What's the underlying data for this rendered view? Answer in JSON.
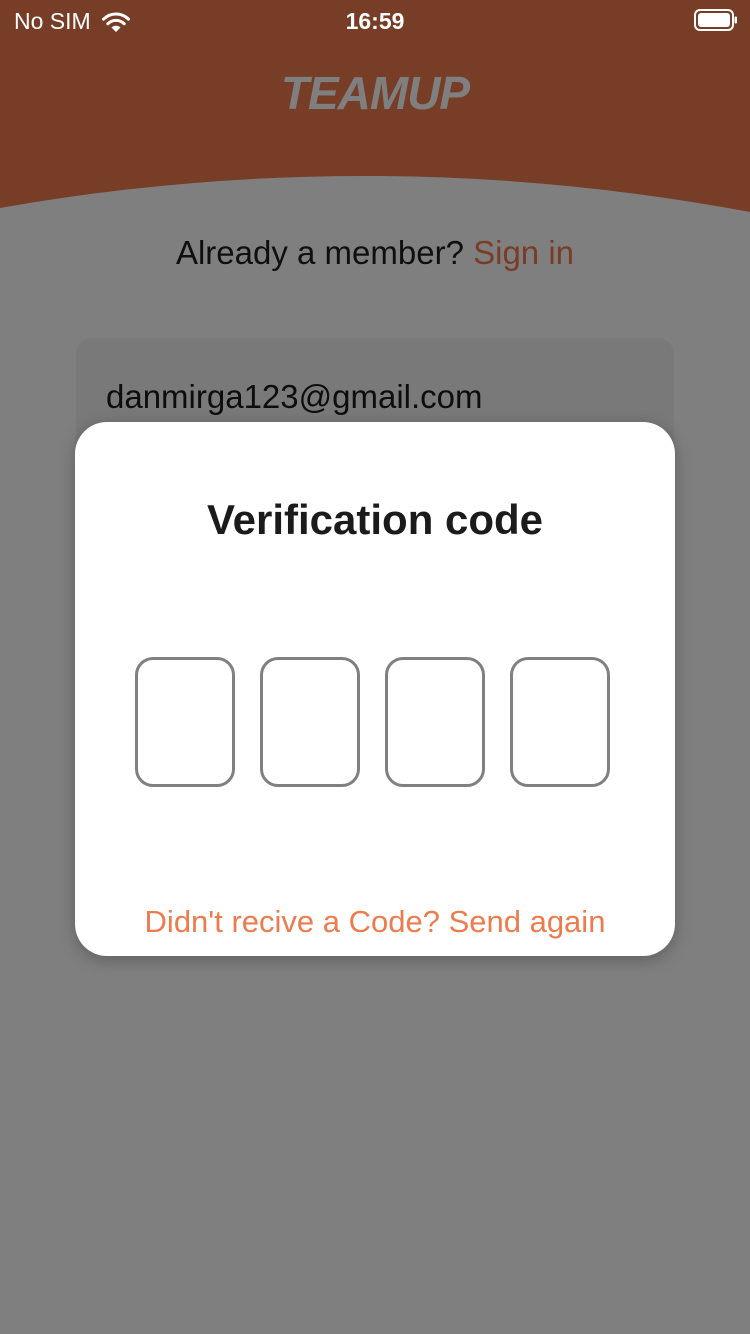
{
  "status_bar": {
    "carrier": "No SIM",
    "time": "16:59",
    "wifi_icon": "wifi-icon",
    "battery_icon": "battery-full-icon"
  },
  "header": {
    "logo_text": "TEAMUP",
    "accent_color": "#ee7b4d"
  },
  "signup": {
    "member_prompt": "Already a member?",
    "signin_label": "Sign in",
    "email_value": "danmirga123@gmail.com"
  },
  "dialog": {
    "title": "Verification code",
    "code_digits": [
      "",
      "",
      "",
      ""
    ],
    "resend_label": "Didn't recive a Code? Send again"
  }
}
